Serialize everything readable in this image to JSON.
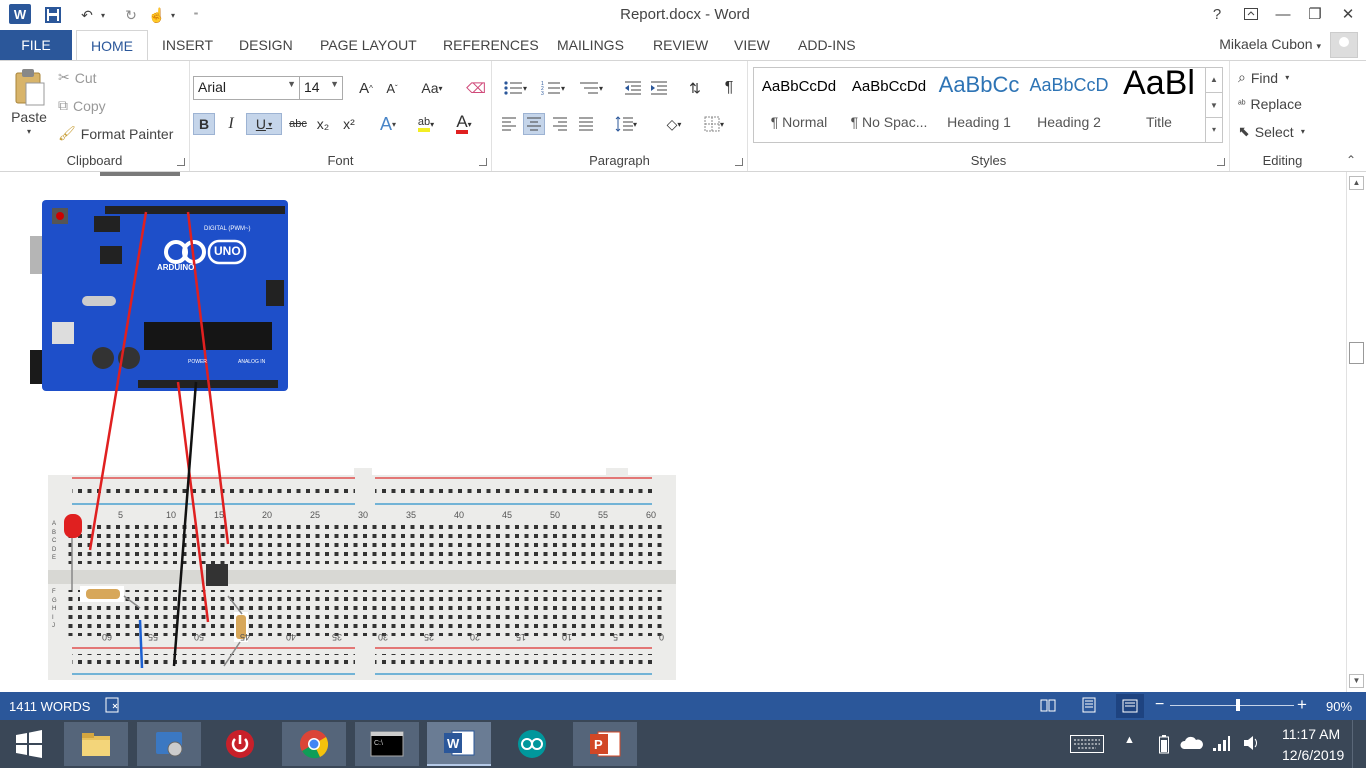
{
  "window": {
    "title": "Report.docx - Word",
    "controls": {
      "help": "?",
      "minimize": "—",
      "restore": "❐",
      "close": "✕"
    }
  },
  "user": {
    "name": "Mikaela Cubon"
  },
  "tabs": {
    "file": "FILE",
    "home": "HOME",
    "insert": "INSERT",
    "design": "DESIGN",
    "page_layout": "PAGE LAYOUT",
    "references": "REFERENCES",
    "mailings": "MAILINGS",
    "review": "REVIEW",
    "view": "VIEW",
    "add_ins": "ADD-INS"
  },
  "clipboard": {
    "label": "Clipboard",
    "paste": "Paste",
    "cut": "Cut",
    "copy": "Copy",
    "format_painter": "Format Painter"
  },
  "font": {
    "label": "Font",
    "name": "Arial",
    "size": "14",
    "grow": "A",
    "shrink": "A",
    "change_case": "Aa",
    "bold": "B",
    "italic": "I",
    "underline": "U",
    "strikethrough": "abc",
    "subscript": "x₂",
    "superscript": "x²",
    "text_effects": "A",
    "highlight": "ab",
    "font_color": "A"
  },
  "paragraph": {
    "label": "Paragraph",
    "show_marks": "¶"
  },
  "styles": {
    "label": "Styles",
    "items": [
      {
        "sample": "AaBbCcDd",
        "name": "¶ Normal"
      },
      {
        "sample": "AaBbCcDd",
        "name": "¶ No Spac..."
      },
      {
        "sample": "AaBbCc",
        "name": "Heading 1"
      },
      {
        "sample": "AaBbCcD",
        "name": "Heading 2"
      },
      {
        "sample": "AaBl",
        "name": "Title"
      }
    ]
  },
  "editing": {
    "label": "Editing",
    "find": "Find",
    "replace": "Replace",
    "select": "Select"
  },
  "breadboard": {
    "top_numbers": [
      "5",
      "10",
      "15",
      "20",
      "25",
      "30",
      "35",
      "40",
      "45",
      "50",
      "55",
      "60"
    ],
    "bottom_numbers": [
      "60",
      "55",
      "50",
      "45",
      "40",
      "35",
      "30",
      "25",
      "20",
      "15",
      "10",
      "5",
      "0"
    ],
    "row_letters_top": [
      "J",
      "I",
      "H",
      "G",
      "F"
    ],
    "row_letters_bottom": [
      "E",
      "D",
      "C",
      "B",
      "A"
    ],
    "arduino_text": {
      "brand": "ARDUINO",
      "model": "UNO",
      "digital": "DIGITAL (PWM~)",
      "power": "POWER",
      "analog": "ANALOG IN"
    }
  },
  "status": {
    "words": "1411 WORDS",
    "zoom": "90%",
    "zoom_level": 0.55
  },
  "taskbar": {
    "time": "11:17 AM",
    "date": "12/6/2019",
    "apps": [
      "File Explorer",
      "Control Panel",
      "Power",
      "Google Chrome",
      "Command Prompt",
      "Word",
      "Arduino",
      "PowerPoint"
    ]
  },
  "colors": {
    "accent": "#2b579a",
    "taskbar": "#3a4757",
    "arduino_board": "#1e4fc9",
    "wire_red": "#e02020",
    "wire_black": "#111111",
    "wire_blue": "#1a5fd1"
  }
}
